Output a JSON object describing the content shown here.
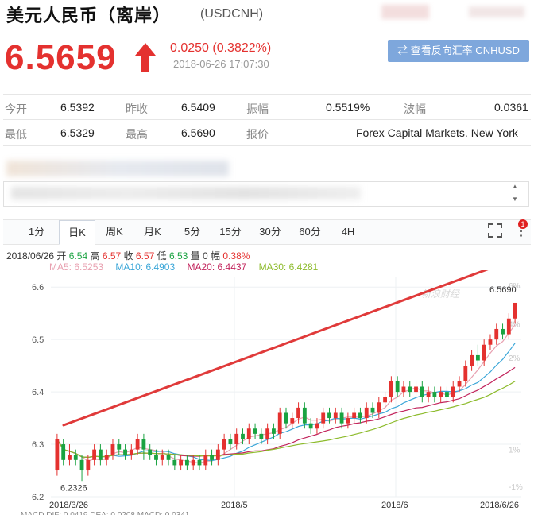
{
  "header": {
    "title": "美元人民币（离岸）",
    "code": "(USDCNH)"
  },
  "quote": {
    "price": "6.5659",
    "change": "0.0250 (0.3822%)",
    "time": "2018-06-26 17:07:30",
    "reverse_button": "查看反向汇率 CNHUSD"
  },
  "stats": {
    "row1": [
      {
        "label": "今开",
        "value": "6.5392"
      },
      {
        "label": "昨收",
        "value": "6.5409"
      },
      {
        "label": "振幅",
        "value": "0.5519%"
      },
      {
        "label": "波幅",
        "value": "0.0361"
      }
    ],
    "row2": [
      {
        "label": "最低",
        "value": "6.5329"
      },
      {
        "label": "最高",
        "value": "6.5690"
      },
      {
        "label": "报价",
        "value": "Forex Capital Markets. New York"
      }
    ]
  },
  "tabs": [
    "1分",
    "日K",
    "周K",
    "月K",
    "5分",
    "15分",
    "30分",
    "60分",
    "4H"
  ],
  "active_tab": "日K",
  "badge": "1",
  "ohlc": {
    "date": "2018/06/26",
    "open_label": "开",
    "open": "6.54",
    "high_label": "高",
    "high": "6.57",
    "close_label": "收",
    "close": "6.57",
    "low_label": "低",
    "low": "6.53",
    "volume_label": "量",
    "volume": "0",
    "amp_label": "幅",
    "amp": "0.38%"
  },
  "ma": [
    {
      "label": "MA5:",
      "value": "6.5253",
      "color": "#e8a0b0"
    },
    {
      "label": "MA10:",
      "value": "6.4903",
      "color": "#3aa6d8"
    },
    {
      "label": "MA20:",
      "value": "6.4437",
      "color": "#c2245c"
    },
    {
      "label": "MA30:",
      "value": "6.4281",
      "color": "#8dbb2c"
    }
  ],
  "macd_text": "MACD DIF: 0.0419   DEA: 0.0208   MACD: 0.0341",
  "colors": {
    "up": "#e4312f",
    "down": "#1aa341",
    "accent": "#7ea7dc"
  },
  "chart_data": {
    "type": "candlestick",
    "ylim": [
      6.2,
      6.62
    ],
    "y_ticks": [
      "6.6",
      "6.5",
      "6.4",
      "6.3",
      "6.2"
    ],
    "pct_ticks": [
      "6%",
      "4%",
      "2%",
      "1%",
      "-1%"
    ],
    "x_labels": [
      "2018/3/26",
      "2018/5",
      "2018/6",
      "2018/6/26"
    ],
    "min_label": "6.2326",
    "max_label": "6.5690",
    "watermark": "新浪财经",
    "candles": [
      [
        6.25,
        6.31,
        6.24,
        6.32
      ],
      [
        6.3,
        6.27,
        6.26,
        6.31
      ],
      [
        6.27,
        6.28,
        6.26,
        6.3
      ],
      [
        6.28,
        6.27,
        6.26,
        6.29
      ],
      [
        6.27,
        6.25,
        6.23,
        6.28
      ],
      [
        6.25,
        6.27,
        6.24,
        6.28
      ],
      [
        6.27,
        6.29,
        6.26,
        6.3
      ],
      [
        6.29,
        6.27,
        6.26,
        6.3
      ],
      [
        6.27,
        6.28,
        6.26,
        6.29
      ],
      [
        6.28,
        6.3,
        6.27,
        6.31
      ],
      [
        6.3,
        6.29,
        6.28,
        6.31
      ],
      [
        6.29,
        6.28,
        6.27,
        6.3
      ],
      [
        6.28,
        6.29,
        6.27,
        6.3
      ],
      [
        6.29,
        6.31,
        6.28,
        6.32
      ],
      [
        6.31,
        6.29,
        6.27,
        6.32
      ],
      [
        6.29,
        6.28,
        6.27,
        6.3
      ],
      [
        6.28,
        6.27,
        6.26,
        6.29
      ],
      [
        6.27,
        6.28,
        6.26,
        6.29
      ],
      [
        6.28,
        6.27,
        6.26,
        6.29
      ],
      [
        6.27,
        6.26,
        6.25,
        6.28
      ],
      [
        6.26,
        6.27,
        6.25,
        6.28
      ],
      [
        6.27,
        6.26,
        6.25,
        6.28
      ],
      [
        6.26,
        6.27,
        6.25,
        6.28
      ],
      [
        6.27,
        6.26,
        6.25,
        6.28
      ],
      [
        6.26,
        6.28,
        6.25,
        6.29
      ],
      [
        6.28,
        6.27,
        6.26,
        6.29
      ],
      [
        6.27,
        6.29,
        6.26,
        6.3
      ],
      [
        6.29,
        6.31,
        6.28,
        6.32
      ],
      [
        6.31,
        6.3,
        6.29,
        6.32
      ],
      [
        6.3,
        6.32,
        6.29,
        6.33
      ],
      [
        6.32,
        6.31,
        6.3,
        6.33
      ],
      [
        6.31,
        6.33,
        6.3,
        6.34
      ],
      [
        6.33,
        6.32,
        6.31,
        6.34
      ],
      [
        6.32,
        6.31,
        6.3,
        6.33
      ],
      [
        6.31,
        6.33,
        6.3,
        6.34
      ],
      [
        6.33,
        6.32,
        6.31,
        6.34
      ],
      [
        6.32,
        6.36,
        6.31,
        6.37
      ],
      [
        6.36,
        6.34,
        6.33,
        6.37
      ],
      [
        6.34,
        6.35,
        6.33,
        6.36
      ],
      [
        6.35,
        6.37,
        6.34,
        6.38
      ],
      [
        6.37,
        6.34,
        6.33,
        6.38
      ],
      [
        6.34,
        6.33,
        6.32,
        6.35
      ],
      [
        6.33,
        6.34,
        6.32,
        6.35
      ],
      [
        6.34,
        6.36,
        6.33,
        6.37
      ],
      [
        6.36,
        6.35,
        6.34,
        6.37
      ],
      [
        6.35,
        6.36,
        6.34,
        6.37
      ],
      [
        6.36,
        6.34,
        6.33,
        6.37
      ],
      [
        6.34,
        6.35,
        6.33,
        6.36
      ],
      [
        6.35,
        6.36,
        6.34,
        6.37
      ],
      [
        6.36,
        6.35,
        6.34,
        6.37
      ],
      [
        6.35,
        6.37,
        6.34,
        6.38
      ],
      [
        6.37,
        6.36,
        6.35,
        6.38
      ],
      [
        6.36,
        6.38,
        6.35,
        6.39
      ],
      [
        6.38,
        6.39,
        6.37,
        6.4
      ],
      [
        6.39,
        6.42,
        6.38,
        6.43
      ],
      [
        6.42,
        6.4,
        6.39,
        6.43
      ],
      [
        6.4,
        6.41,
        6.39,
        6.42
      ],
      [
        6.41,
        6.4,
        6.39,
        6.42
      ],
      [
        6.4,
        6.41,
        6.39,
        6.42
      ],
      [
        6.41,
        6.39,
        6.38,
        6.42
      ],
      [
        6.39,
        6.4,
        6.38,
        6.41
      ],
      [
        6.4,
        6.39,
        6.38,
        6.41
      ],
      [
        6.39,
        6.4,
        6.38,
        6.41
      ],
      [
        6.4,
        6.39,
        6.38,
        6.41
      ],
      [
        6.39,
        6.41,
        6.38,
        6.42
      ],
      [
        6.41,
        6.42,
        6.4,
        6.43
      ],
      [
        6.42,
        6.45,
        6.41,
        6.46
      ],
      [
        6.45,
        6.47,
        6.44,
        6.48
      ],
      [
        6.47,
        6.46,
        6.45,
        6.49
      ],
      [
        6.46,
        6.49,
        6.45,
        6.5
      ],
      [
        6.49,
        6.5,
        6.48,
        6.51
      ],
      [
        6.5,
        6.52,
        6.49,
        6.53
      ],
      [
        6.52,
        6.51,
        6.5,
        6.53
      ],
      [
        6.51,
        6.54,
        6.5,
        6.55
      ],
      [
        6.54,
        6.57,
        6.53,
        6.57
      ]
    ]
  }
}
